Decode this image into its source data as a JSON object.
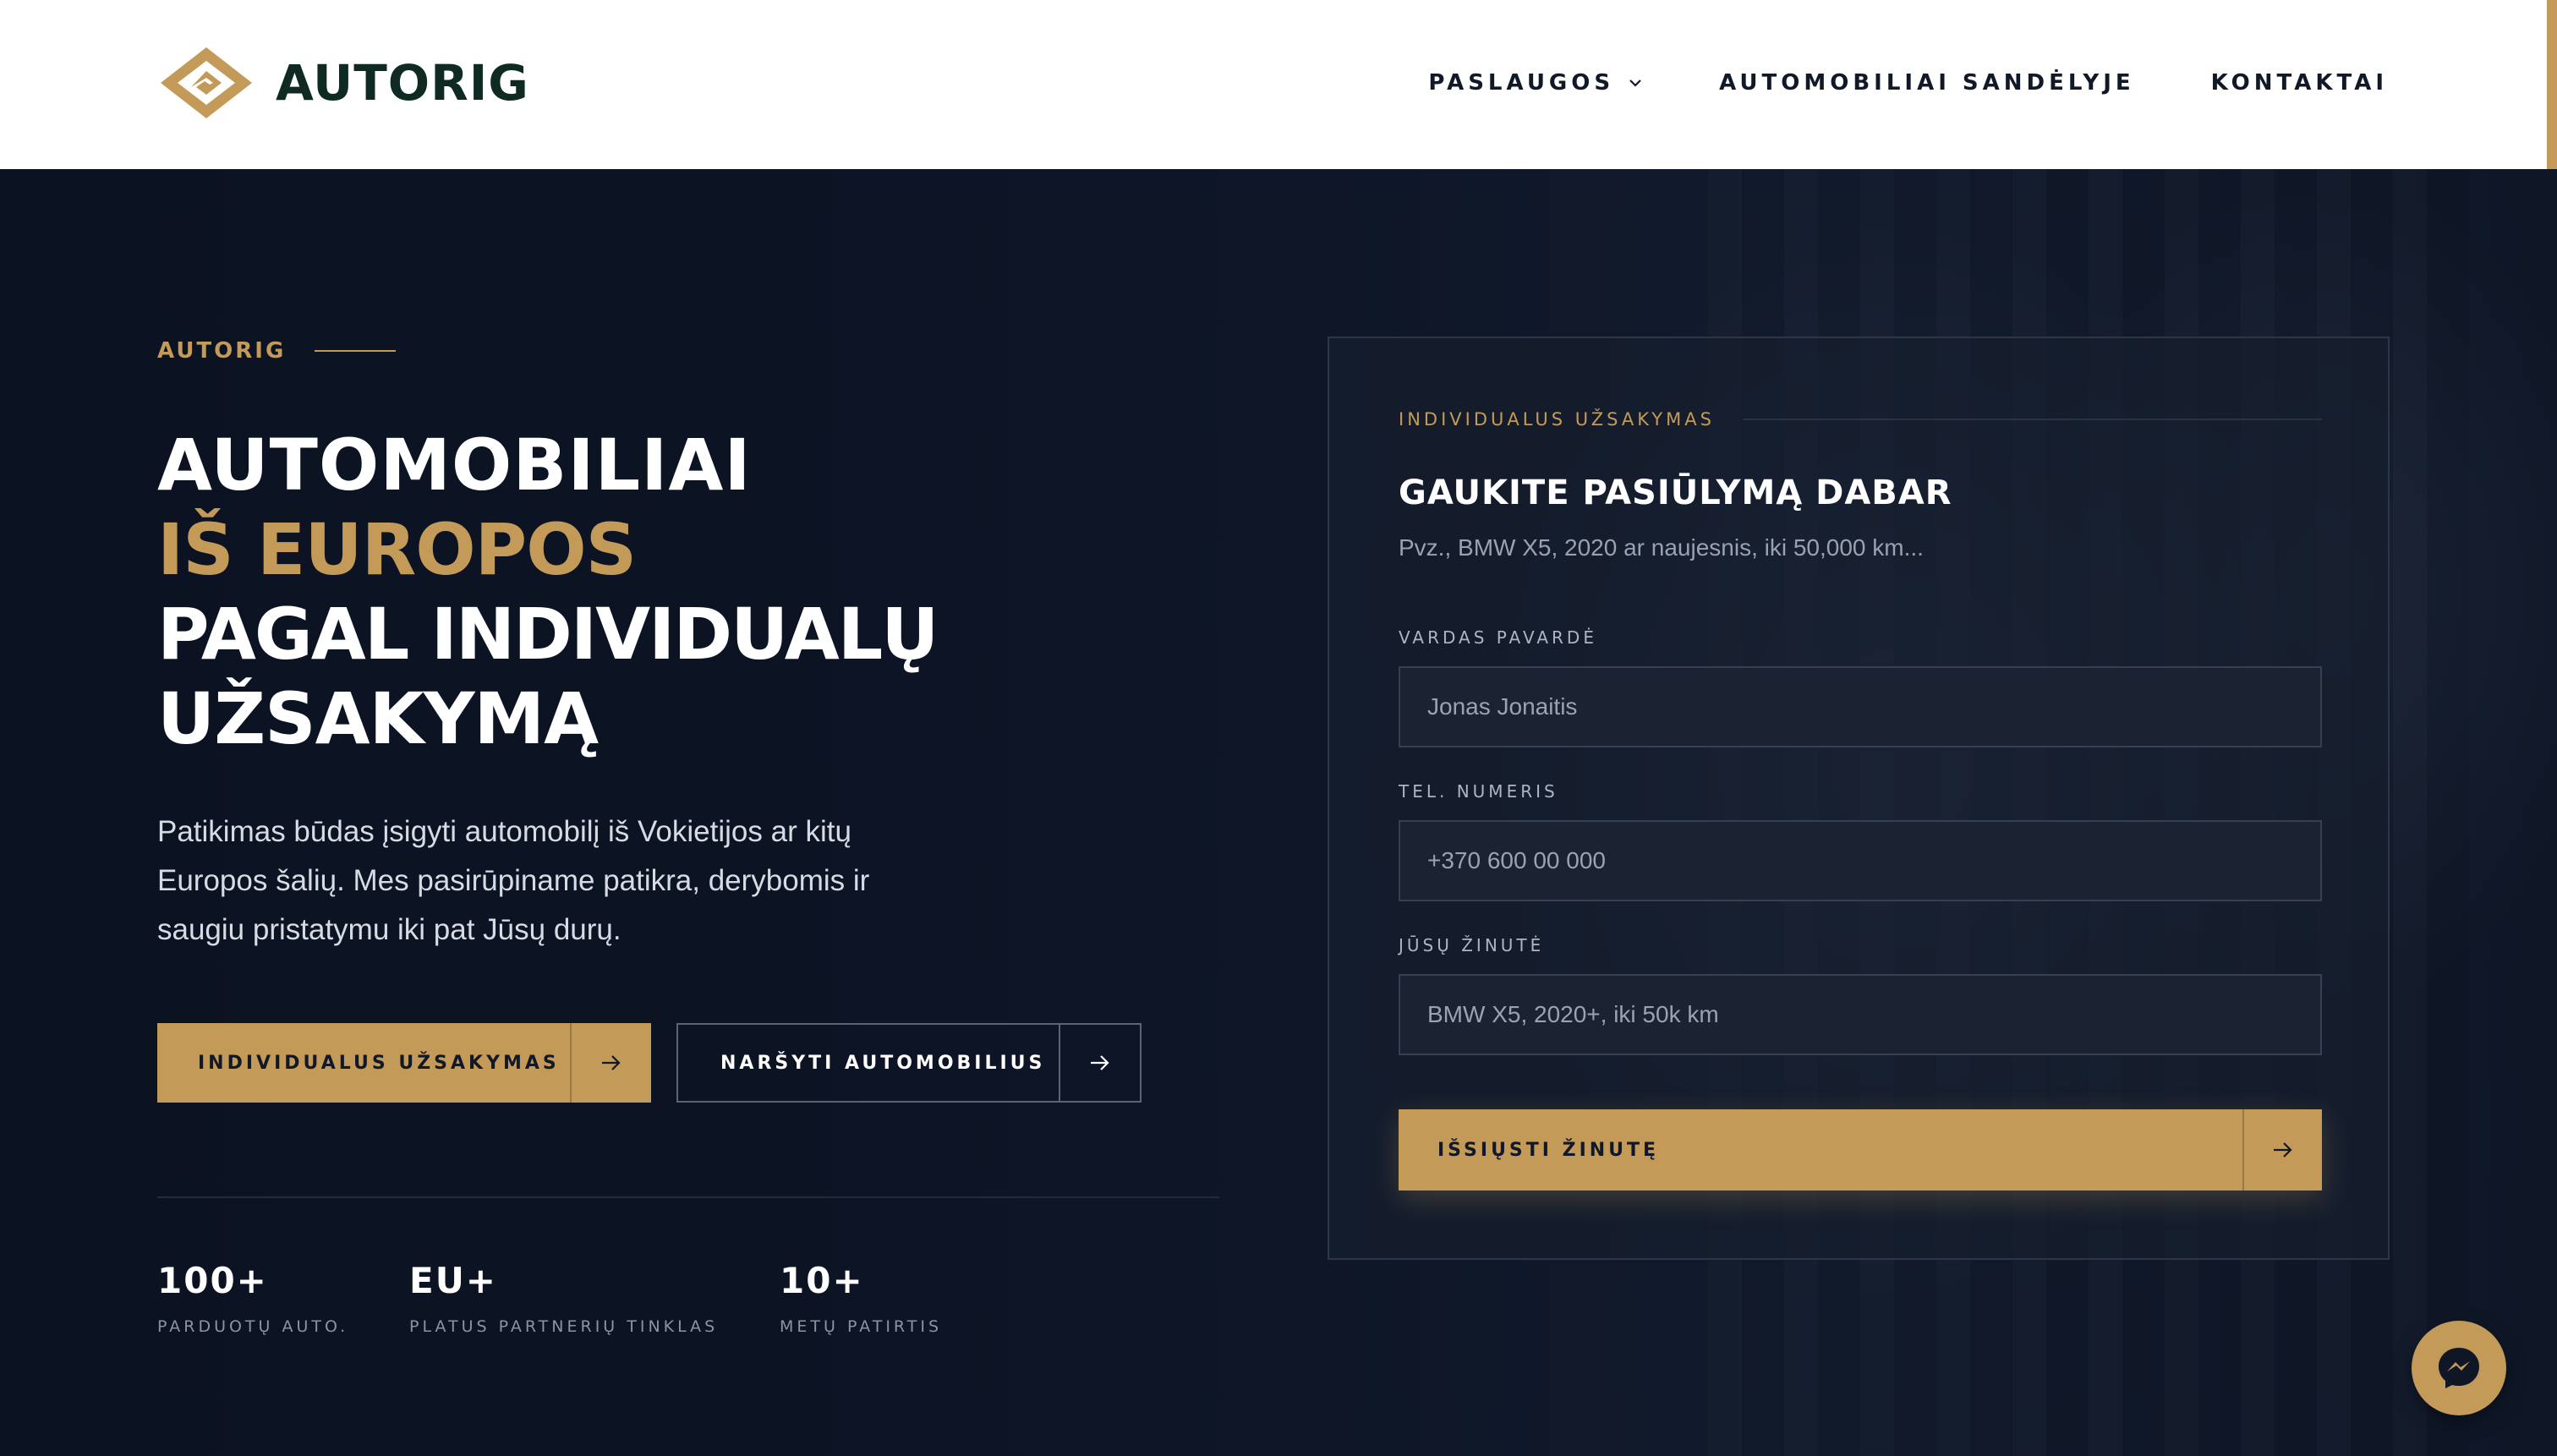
{
  "brand": {
    "name": "AUTORIG",
    "accent": "#c49a58",
    "dark": "#0f2a22"
  },
  "nav": {
    "items": [
      {
        "label": "PASLAUGOS",
        "has_dropdown": true
      },
      {
        "label": "AUTOMOBILIAI SANDĖLYJE"
      },
      {
        "label": "KONTAKTAI"
      }
    ]
  },
  "hero": {
    "eyebrow": "AUTORIG",
    "title_line1": "AUTOMOBILIAI",
    "title_line2": "IŠ EUROPOS",
    "title_line3": "PAGAL INDIVIDUALŲ",
    "title_line4": "UŽSAKYMĄ",
    "lead": "Patikimas būdas įsigyti automobilį iš Vokietijos ar kitų Europos šalių. Mes pasirūpiname patikra, derybomis ir saugiu pristatymu iki pat Jūsų durų.",
    "primary_button": "INDIVIDUALUS UŽSAKYMAS",
    "secondary_button": "NARŠYTI AUTOMOBILIUS",
    "stats": [
      {
        "value": "100+",
        "label": "PARDUOTŲ AUTO."
      },
      {
        "value": "EU+",
        "label": "PLATUS PARTNERIŲ TINKLAS"
      },
      {
        "value": "10+",
        "label": "METŲ PATIRTIS"
      }
    ]
  },
  "form": {
    "eyebrow": "INDIVIDUALUS UŽSAKYMAS",
    "title": "GAUKITE PASIŪLYMĄ DABAR",
    "subtitle": "Pvz., BMW X5, 2020 ar naujesnis, iki 50,000 km...",
    "fields": [
      {
        "label": "VARDAS PAVARDĖ",
        "placeholder": "Jonas Jonaitis"
      },
      {
        "label": "TEL. NUMERIS",
        "placeholder": "+370 600 00 000"
      },
      {
        "label": "JŪSŲ ŽINUTĖ",
        "placeholder": "BMW X5, 2020+, iki 50k km"
      }
    ],
    "submit": "IŠSIŲSTI ŽINUTĘ"
  },
  "icons": {
    "chat": "messenger-icon",
    "arrow": "arrow-right-icon",
    "dropdown": "chevron-down-icon"
  }
}
